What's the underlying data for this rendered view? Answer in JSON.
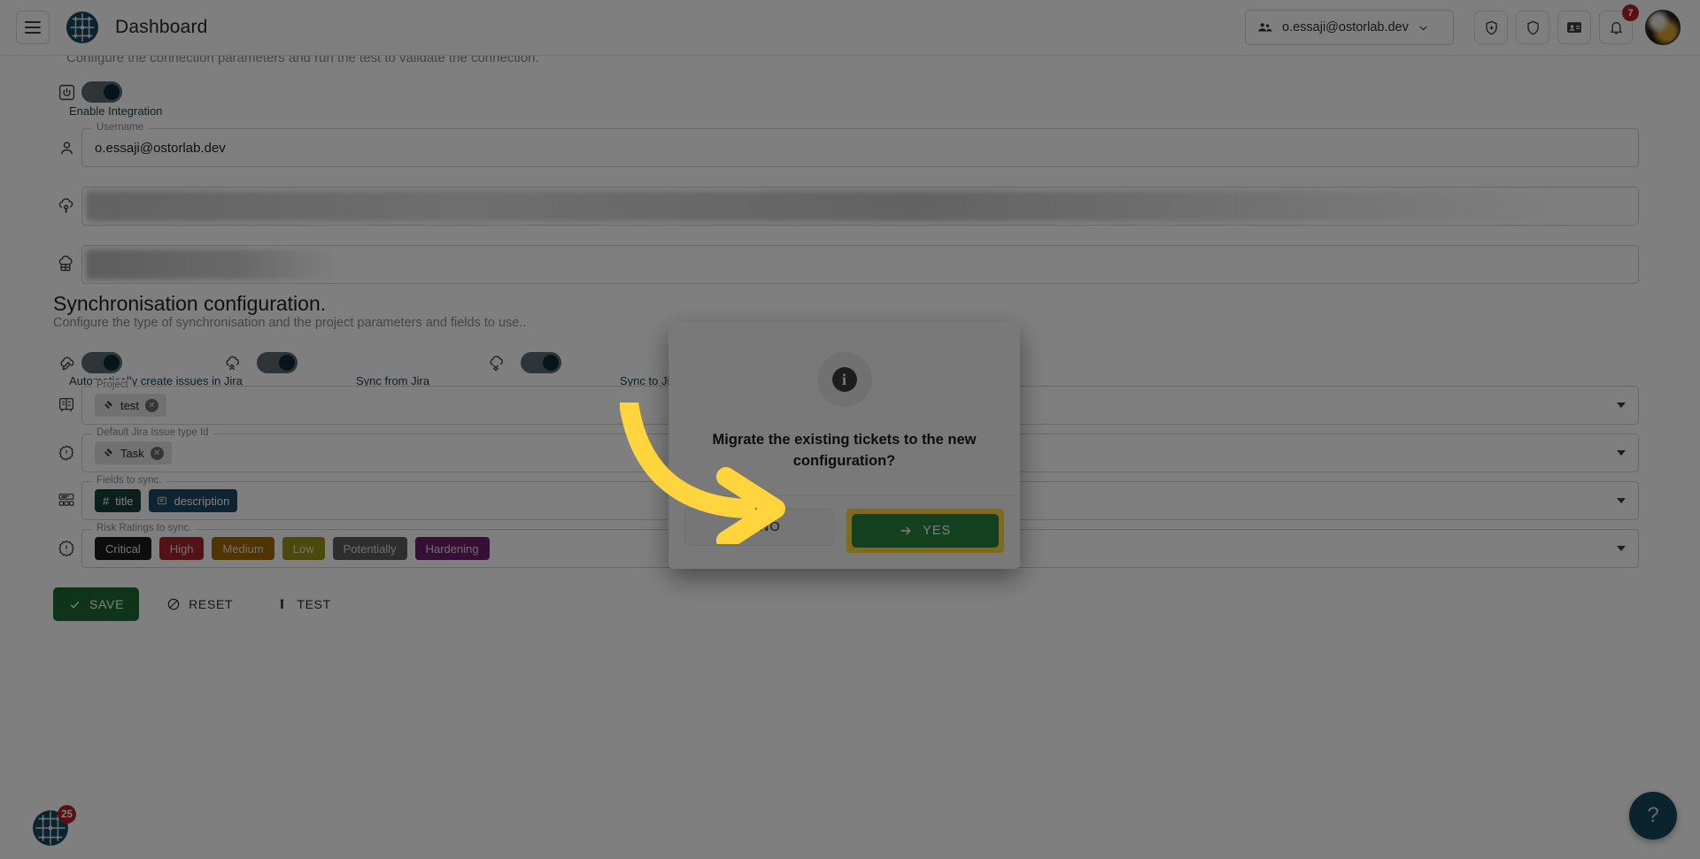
{
  "header": {
    "menu_icon": "hamburger-icon",
    "logo_icon": "ostorlab-circuit-logo",
    "title": "Dashboard",
    "org_select": {
      "value": "o.essaji@ostorlab.dev",
      "icon": "people-group-icon",
      "caret": "chevron-down-icon"
    },
    "actions": [
      {
        "name": "add-scan-button",
        "icon": "shield-plus-icon"
      },
      {
        "name": "security-button",
        "icon": "shield-icon"
      },
      {
        "name": "tickets-button",
        "icon": "id-card-icon"
      },
      {
        "name": "notifications-button",
        "icon": "bell-icon",
        "badge": "7"
      }
    ],
    "avatar_name": "user-avatar"
  },
  "connection_section": {
    "description": "Configure the connection parameters and run the test to validate the connection."
  },
  "enable_integration": {
    "icon": "power-icon",
    "label": "Enable Integration",
    "state": "on"
  },
  "fields": {
    "username": {
      "legend": "Username",
      "value": "o.essaji@ostorlab.dev",
      "icon": "person-icon"
    },
    "api_key": {
      "legend": "",
      "value": "",
      "icon": "cloud-key-icon",
      "redacted": true
    },
    "url": {
      "legend": "",
      "value": "",
      "icon": "cloud-server-icon",
      "redacted": true
    }
  },
  "sync_section": {
    "title": "Synchronisation configuration.",
    "subtitle": "Configure the type of synchronisation and the project parameters and fields to use.."
  },
  "sync_toggles": [
    {
      "name": "auto-create-issues-toggle",
      "icon": "cloud-pencil-icon",
      "label": "Automatically create issues in Jira",
      "state": "on"
    },
    {
      "name": "sync-from-jira-toggle",
      "icon": "cloud-up-icon",
      "label": "Sync from Jira",
      "state": "on"
    },
    {
      "name": "sync-to-jira-toggle",
      "icon": "cloud-down-icon",
      "label": "Sync to Jira",
      "state": "on"
    }
  ],
  "selects": [
    {
      "name": "project-select",
      "legend": "Project",
      "icon": "kanban-board-icon",
      "chips": [
        {
          "label": "test",
          "icon": "jira-icon",
          "removable": true
        }
      ]
    },
    {
      "name": "default-issue-type-select",
      "legend": "Default Jira Issue type Id",
      "icon": "gear-alert-icon",
      "chips": [
        {
          "label": "Task",
          "icon": "jira-icon",
          "removable": true
        }
      ]
    },
    {
      "name": "fields-to-sync-select",
      "legend": "Fields to sync.",
      "icon": "form-fields-icon",
      "chips": [
        {
          "label": "title",
          "icon": "hash-icon",
          "color": "#17403a",
          "text_color": "#ffffff"
        },
        {
          "label": "description",
          "icon": "paragraph-icon",
          "color": "#1e4861",
          "text_color": "#ffffff"
        }
      ]
    },
    {
      "name": "risk-ratings-to-sync-select",
      "legend": "Risk Ratings to sync.",
      "icon": "warning-badge-icon",
      "chips": [
        {
          "label": "Critical",
          "color": "#1a1a1a",
          "text_color": "#e8e8e8"
        },
        {
          "label": "High",
          "color": "#a2262c",
          "text_color": "#f0dada"
        },
        {
          "label": "Medium",
          "color": "#a06a00",
          "text_color": "#efe2c8"
        },
        {
          "label": "Low",
          "color": "#9b9118",
          "text_color": "#ece9c5"
        },
        {
          "label": "Potentially",
          "color": "#5c5c5c",
          "text_color": "#dddddd"
        },
        {
          "label": "Hardening",
          "color": "#6b1e6b",
          "text_color": "#efd5ef"
        }
      ]
    }
  ],
  "action_buttons": [
    {
      "name": "save-button",
      "label": "SAVE",
      "icon": "check-icon",
      "style": "primary"
    },
    {
      "name": "reset-button",
      "label": "RESET",
      "icon": "ban-icon",
      "style": "ghost"
    },
    {
      "name": "test-button",
      "label": "TEST",
      "icon": "test-tube-icon",
      "style": "ghost"
    }
  ],
  "chat_fab": {
    "name": "support-chat-button",
    "badge": "25",
    "icon": "ostorlab-circuit-logo"
  },
  "help_fab": {
    "name": "help-button",
    "label": "?"
  },
  "dialog": {
    "icon": "info-icon",
    "glyph": "i",
    "message": "Migrate the existing tickets to the new configuration?",
    "no_button": {
      "label": "NO",
      "icon": "close-icon"
    },
    "yes_button": {
      "label": "YES",
      "icon": "arrow-right-icon"
    }
  },
  "annotation": {
    "arrow_color": "#ffd43d",
    "highlight_color": "#ffd43d"
  },
  "colors": {
    "accent_green": "#27813c",
    "danger_red": "#b32128",
    "dark_teal": "#17475a",
    "highlight_yellow": "#ffd43d"
  }
}
